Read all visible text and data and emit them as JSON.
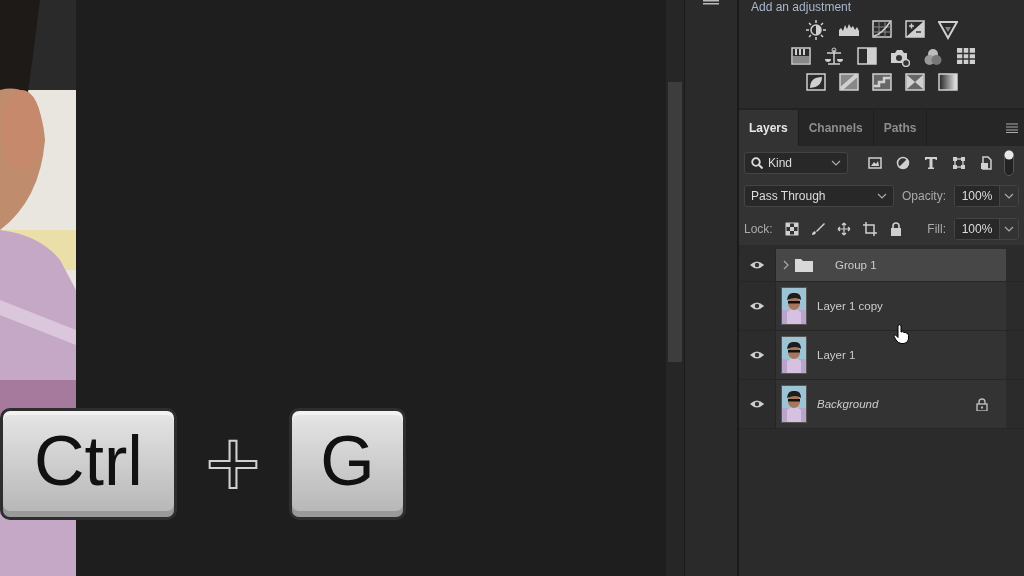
{
  "adjustments": {
    "title": "Add an adjustment"
  },
  "tabs": [
    {
      "label": "Layers",
      "selected": true
    },
    {
      "label": "Channels",
      "selected": false
    },
    {
      "label": "Paths",
      "selected": false
    }
  ],
  "filter": {
    "value": "Kind"
  },
  "blend_mode": {
    "value": "Pass Through"
  },
  "opacity": {
    "label": "Opacity:",
    "value": "100%"
  },
  "lock": {
    "label": "Lock:"
  },
  "fill": {
    "label": "Fill:",
    "value": "100%"
  },
  "layers": [
    {
      "kind": "group",
      "name": "Group 1",
      "visible": true,
      "selected": true,
      "locked": false
    },
    {
      "kind": "layer",
      "name": "Layer 1 copy",
      "visible": true,
      "selected": false,
      "locked": false
    },
    {
      "kind": "layer",
      "name": "Layer 1",
      "visible": true,
      "selected": false,
      "locked": false
    },
    {
      "kind": "background",
      "name": "Background",
      "visible": true,
      "selected": false,
      "locked": true
    }
  ],
  "shortcut": {
    "keys": [
      "Ctrl",
      "G"
    ],
    "separator": "+"
  }
}
